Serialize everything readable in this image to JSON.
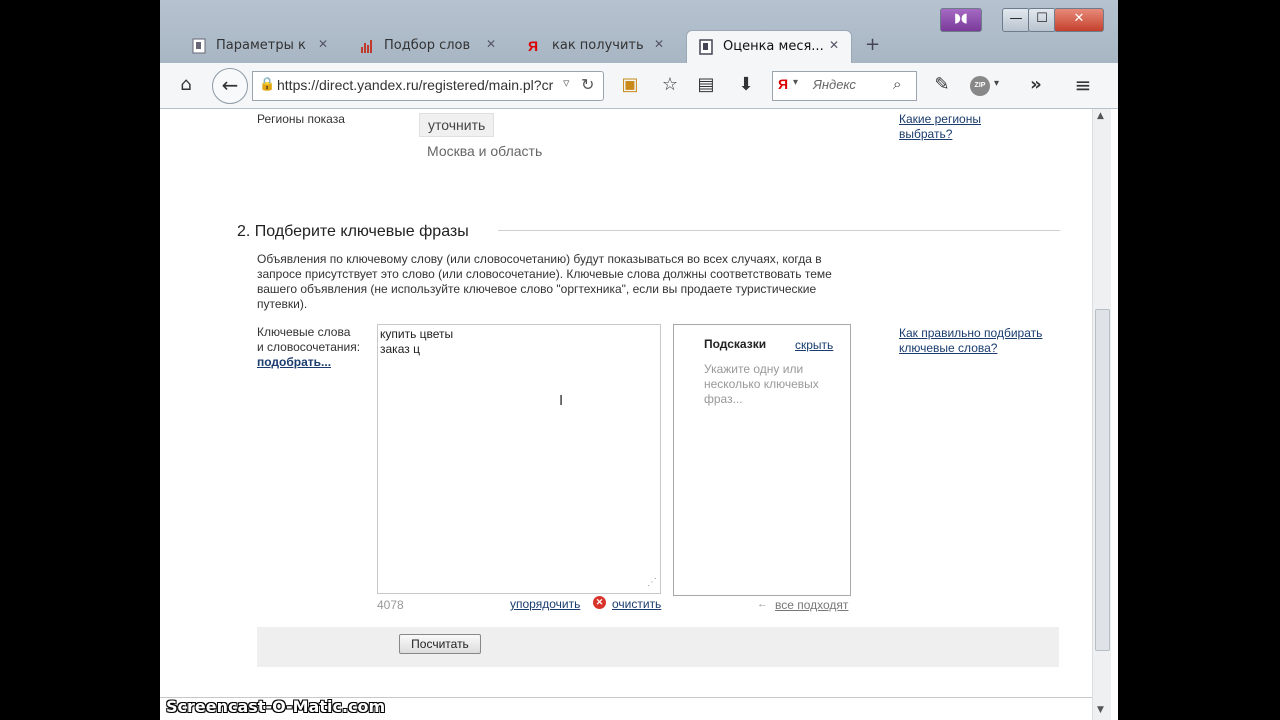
{
  "tabs": [
    {
      "label": "Параметры к",
      "icon": "page-icon"
    },
    {
      "label": "Подбор слов",
      "icon": "chart-icon"
    },
    {
      "label": "как получить",
      "icon": "yandex-icon"
    },
    {
      "label": "Оценка меся...",
      "icon": "page-icon",
      "active": true
    }
  ],
  "address": {
    "url": "https://direct.yandex.ru/registered/main.pl?cr"
  },
  "search": {
    "placeholder": "Яндекс",
    "engine_label": "Я"
  },
  "regions": {
    "label": "Регионы показа",
    "refine_button": "уточнить",
    "value": "Москва и область",
    "help_link": "Какие регионы выбрать?"
  },
  "section2": {
    "title": "2. Подберите ключевые фразы",
    "description": "Объявления по ключевому слову (или словосочетанию) будут показываться во всех случаях, когда в запросе присутствует это слово (или словосочетание). Ключевые слова должны соответствовать теме вашего объявления (не используйте ключевое слово \"оргтехника\", если вы продаете туристические путевки).",
    "keywords_label_line1": "Ключевые слова",
    "keywords_label_line2": "и словосочетания:",
    "pick_link": "подобрать...",
    "keywords_value": "купить цветы\nзаказ ц",
    "char_count": "4078",
    "sort_link": "упорядочить",
    "clear_link": "очистить",
    "hints_title": "Подсказки",
    "hide_link": "скрыть",
    "hints_placeholder": "Укажите одну или несколько ключевых фраз...",
    "all_fit_link": "все подходят",
    "help_link": "Как правильно подбирать ключевые слова?",
    "calc_button": "Посчитать"
  },
  "watermark": "Screencast-O-Matic.com",
  "colors": {
    "link": "#1a3c6e",
    "clear_icon": "#d9342b"
  }
}
